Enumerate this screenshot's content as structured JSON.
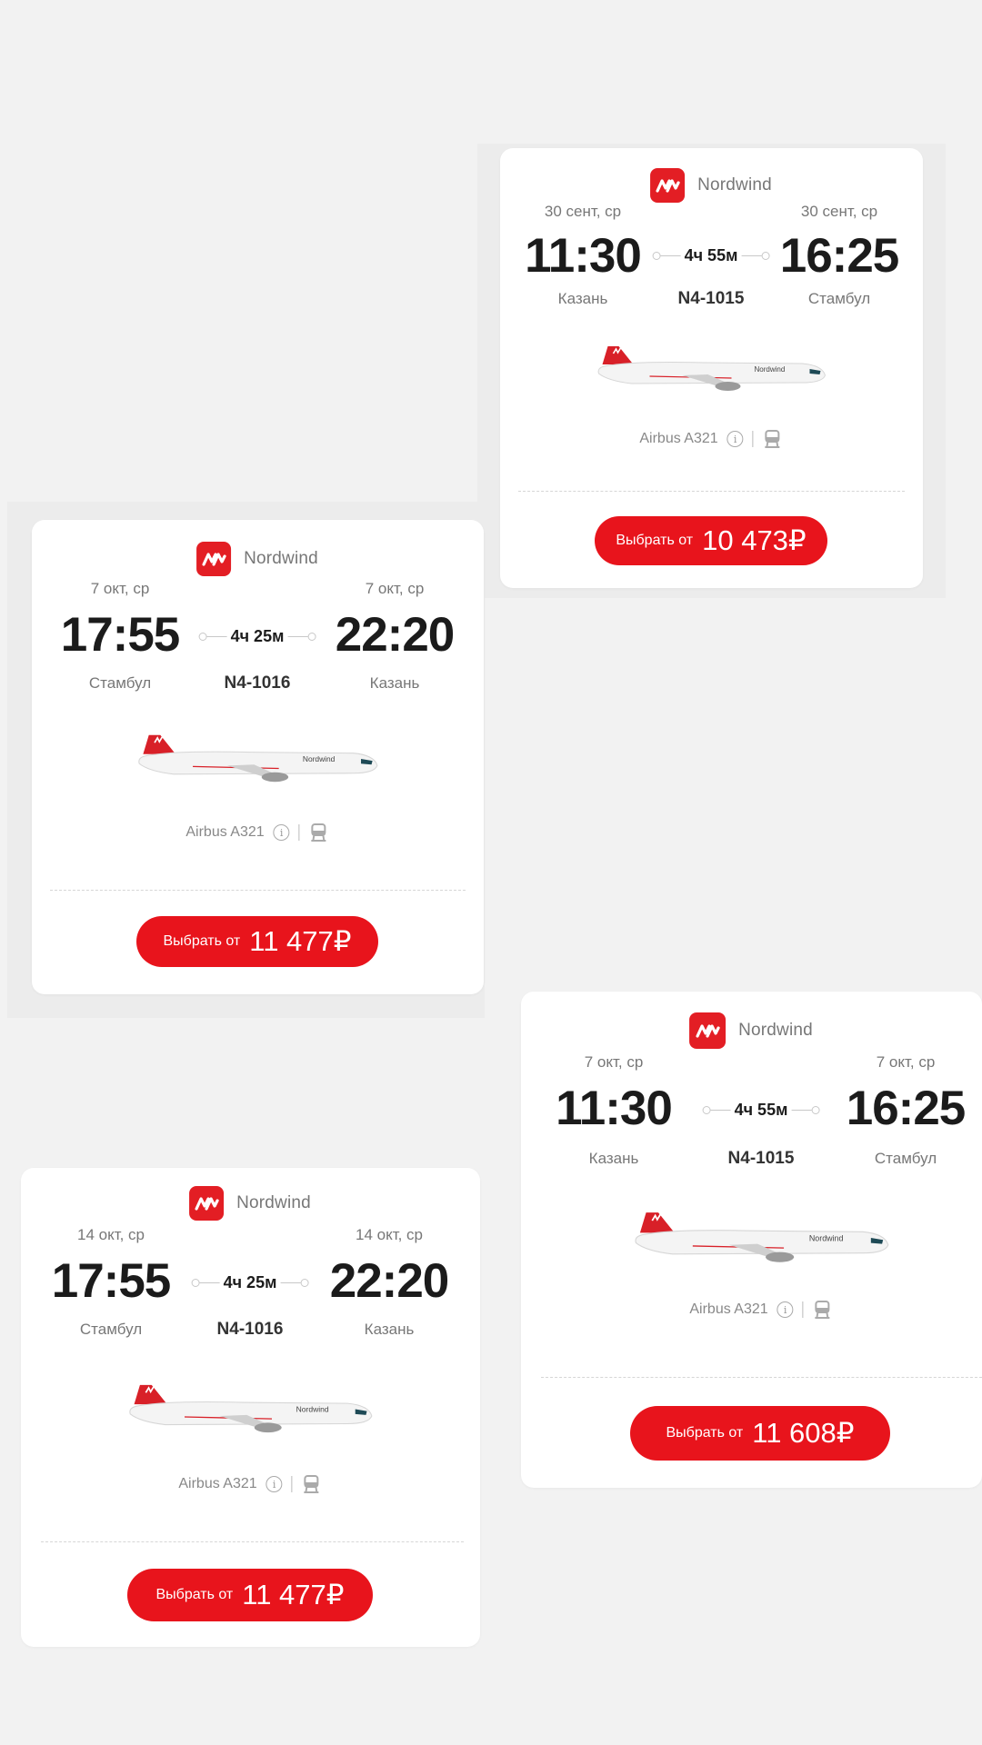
{
  "colors": {
    "brand": "#e31e24",
    "button": "#e8141c",
    "background": "#f2f2f2"
  },
  "cards": [
    {
      "airline": "Nordwind",
      "logo_icon": "nordwind-logo-icon",
      "dep_date": "30 сент, ср",
      "arr_date": "30 сент, ср",
      "dep_time": "11:30",
      "arr_time": "16:25",
      "duration": "4ч 55м",
      "dep_city": "Казань",
      "arr_city": "Стамбул",
      "flight": "N4-1015",
      "aircraft": "Airbus A321",
      "info_icon": "info-icon",
      "seat_icon": "seat-icon",
      "button_label": "Выбрать от",
      "price": "10 473₽"
    },
    {
      "airline": "Nordwind",
      "logo_icon": "nordwind-logo-icon",
      "dep_date": "7 окт, ср",
      "arr_date": "7 окт, ср",
      "dep_time": "17:55",
      "arr_time": "22:20",
      "duration": "4ч 25м",
      "dep_city": "Стамбул",
      "arr_city": "Казань",
      "flight": "N4-1016",
      "aircraft": "Airbus A321",
      "info_icon": "info-icon",
      "seat_icon": "seat-icon",
      "button_label": "Выбрать от",
      "price": "11 477₽"
    },
    {
      "airline": "Nordwind",
      "logo_icon": "nordwind-logo-icon",
      "dep_date": "7 окт, ср",
      "arr_date": "7 окт, ср",
      "dep_time": "11:30",
      "arr_time": "16:25",
      "duration": "4ч 55м",
      "dep_city": "Казань",
      "arr_city": "Стамбул",
      "flight": "N4-1015",
      "aircraft": "Airbus A321",
      "info_icon": "info-icon",
      "seat_icon": "seat-icon",
      "button_label": "Выбрать от",
      "price": "11 608₽"
    },
    {
      "airline": "Nordwind",
      "logo_icon": "nordwind-logo-icon",
      "dep_date": "14 окт, ср",
      "arr_date": "14 окт, ср",
      "dep_time": "17:55",
      "arr_time": "22:20",
      "duration": "4ч 25м",
      "dep_city": "Стамбул",
      "arr_city": "Казань",
      "flight": "N4-1016",
      "aircraft": "Airbus A321",
      "info_icon": "info-icon",
      "seat_icon": "seat-icon",
      "button_label": "Выбрать от",
      "price": "11 477₽"
    }
  ]
}
